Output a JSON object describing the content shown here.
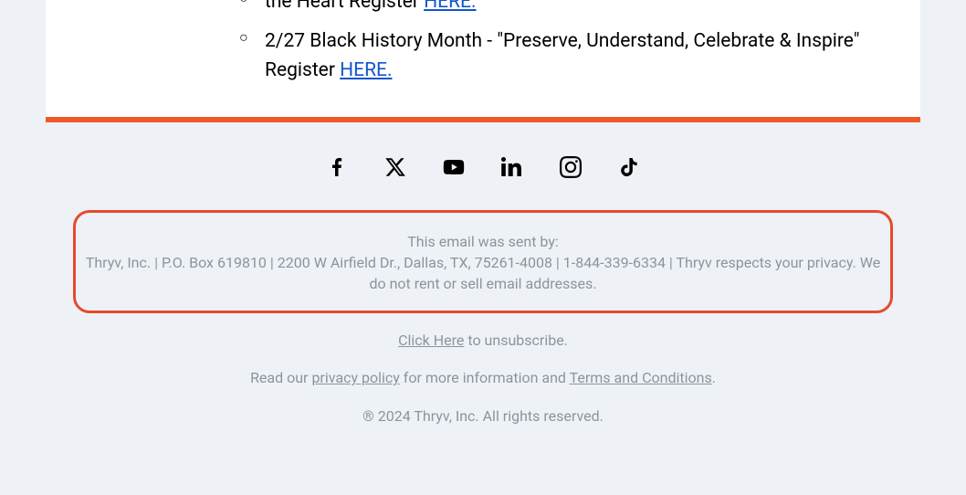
{
  "content": {
    "item1_partial": "the Heart Register ",
    "item1_link": "HERE.",
    "item2_text_a": "2/27 Black History Month - \"Preserve, Understand, Celebrate & Inspire\" Register ",
    "item2_link": "HERE."
  },
  "footer": {
    "sent_by_label": "This email was sent by:",
    "sent_by_detail": "Thryv, Inc. | P.O. Box 619810 | 2200 W Airfield Dr., Dallas, TX, 75261-4008 | 1-844-339-6334 | Thryv respects your privacy. We do not rent or sell email addresses.",
    "unsubscribe_link": "Click Here",
    "unsubscribe_suffix": " to unsubscribe.",
    "policy_prefix": "Read our ",
    "privacy_link": "privacy policy",
    "policy_middle": " for more information and ",
    "terms_link": "Terms and Conditions",
    "policy_suffix": ".",
    "copyright": "® 2024 Thryv, Inc. All rights reserved."
  }
}
